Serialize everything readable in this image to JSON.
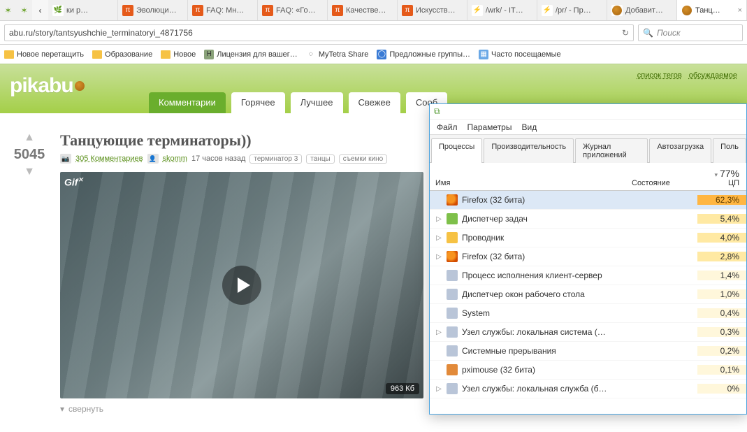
{
  "tabs_strip": {
    "back_icon": "‹",
    "tabs": [
      {
        "label": "ки р…",
        "favicon": "grass"
      },
      {
        "label": "Эволюци…",
        "favicon": "pi"
      },
      {
        "label": "FAQ: Мн…",
        "favicon": "pi"
      },
      {
        "label": "FAQ: «Го…",
        "favicon": "pi"
      },
      {
        "label": "Качестве…",
        "favicon": "pi"
      },
      {
        "label": "Искусств…",
        "favicon": "pi"
      },
      {
        "label": "/wrk/ - IT…",
        "favicon": "bolt"
      },
      {
        "label": "/pr/ - Пр…",
        "favicon": "bolt"
      },
      {
        "label": "Добавит…",
        "favicon": "cookie"
      },
      {
        "label": "Танц…",
        "favicon": "cookie",
        "active": true
      }
    ]
  },
  "urlbar": {
    "url": "abu.ru/story/tantsyushchie_terminatoryi_4871756",
    "reload_glyph": "↻"
  },
  "search": {
    "placeholder": "Поиск",
    "magnifier": "🔍"
  },
  "bookmarks": [
    {
      "icon": "folder",
      "label": "Новое перетащить"
    },
    {
      "icon": "folder",
      "label": "Образование"
    },
    {
      "icon": "folder",
      "label": "Новое"
    },
    {
      "icon": "H",
      "label": "Лицензия для вашег…",
      "iconbg": "#8aa27a"
    },
    {
      "icon": "◌",
      "label": "MyTetra Share",
      "iconbg": "#fff"
    },
    {
      "icon": "◯",
      "label": "Предложные группы…",
      "iconbg": "#3a7bd5",
      "iconcolor": "#fff"
    },
    {
      "icon": "▦",
      "label": "Часто посещаемые",
      "iconbg": "#6aa8e6",
      "iconcolor": "#fff"
    }
  ],
  "pikabu": {
    "logo": "pikabu",
    "header_links": [
      "список тегов",
      "обсуждаемое"
    ],
    "nav": [
      {
        "label": "Комментарии",
        "active": true
      },
      {
        "label": "Горячее"
      },
      {
        "label": "Лучшее"
      },
      {
        "label": "Свежее"
      },
      {
        "label": "Сооб"
      }
    ],
    "post": {
      "score": "5045",
      "up": "▲",
      "down": "▼",
      "title": "Танцующие терминаторы))",
      "camera_glyph": "📷",
      "comments_text": "305 Комментариев",
      "user_glyph": "👤",
      "user": "skomm",
      "time_ago": "17 часов назад",
      "tags": [
        "терминатор 3",
        "танцы",
        "съемки кино"
      ],
      "gif_label": "Gif",
      "gif_label_sup": "✕",
      "gif_size": "963 Кб",
      "collapse": "свернуть",
      "caret": "▾"
    }
  },
  "taskmgr": {
    "title_icon": "⧉",
    "menu": [
      "Файл",
      "Параметры",
      "Вид"
    ],
    "tabs": [
      {
        "label": "Процессы",
        "active": true
      },
      {
        "label": "Производительность"
      },
      {
        "label": "Журнал приложений"
      },
      {
        "label": "Автозагрузка"
      },
      {
        "label": "Поль"
      }
    ],
    "columns": {
      "name": "Имя",
      "state": "Состояние",
      "cpu_val": "77%",
      "cpu_lbl": "ЦП"
    },
    "rows": [
      {
        "exp": "",
        "icon": "pi-ff",
        "name": "Firefox (32 бита)",
        "cpu": "62,3%",
        "heat": "heat3",
        "selected": true
      },
      {
        "exp": "▷",
        "icon": "pi-tm",
        "name": "Диспетчер задач",
        "cpu": "5,4%",
        "heat": "heat1"
      },
      {
        "exp": "▷",
        "icon": "pi-folder",
        "name": "Проводник",
        "cpu": "4,0%",
        "heat": "heat1"
      },
      {
        "exp": "▷",
        "icon": "pi-ff",
        "name": "Firefox (32 бита)",
        "cpu": "2,8%",
        "heat": "heat1"
      },
      {
        "exp": "",
        "icon": "pi-sys",
        "name": "Процесс исполнения клиент-сервер",
        "cpu": "1,4%",
        "heat": "heat0"
      },
      {
        "exp": "",
        "icon": "pi-sys",
        "name": "Диспетчер окон рабочего стола",
        "cpu": "1,0%",
        "heat": "heat0"
      },
      {
        "exp": "",
        "icon": "pi-sys",
        "name": "System",
        "cpu": "0,4%",
        "heat": "heat0"
      },
      {
        "exp": "▷",
        "icon": "pi-sys",
        "name": "Узел службы: локальная система (…",
        "cpu": "0,3%",
        "heat": "heat0"
      },
      {
        "exp": "",
        "icon": "pi-sys",
        "name": "Системные прерывания",
        "cpu": "0,2%",
        "heat": "heat0"
      },
      {
        "exp": "",
        "icon": "pi-px",
        "name": "pximouse (32 бита)",
        "cpu": "0,1%",
        "heat": "heat0"
      },
      {
        "exp": "▷",
        "icon": "pi-sys",
        "name": "Узел службы: локальная служба (б…",
        "cpu": "0%",
        "heat": "heat0"
      }
    ]
  }
}
